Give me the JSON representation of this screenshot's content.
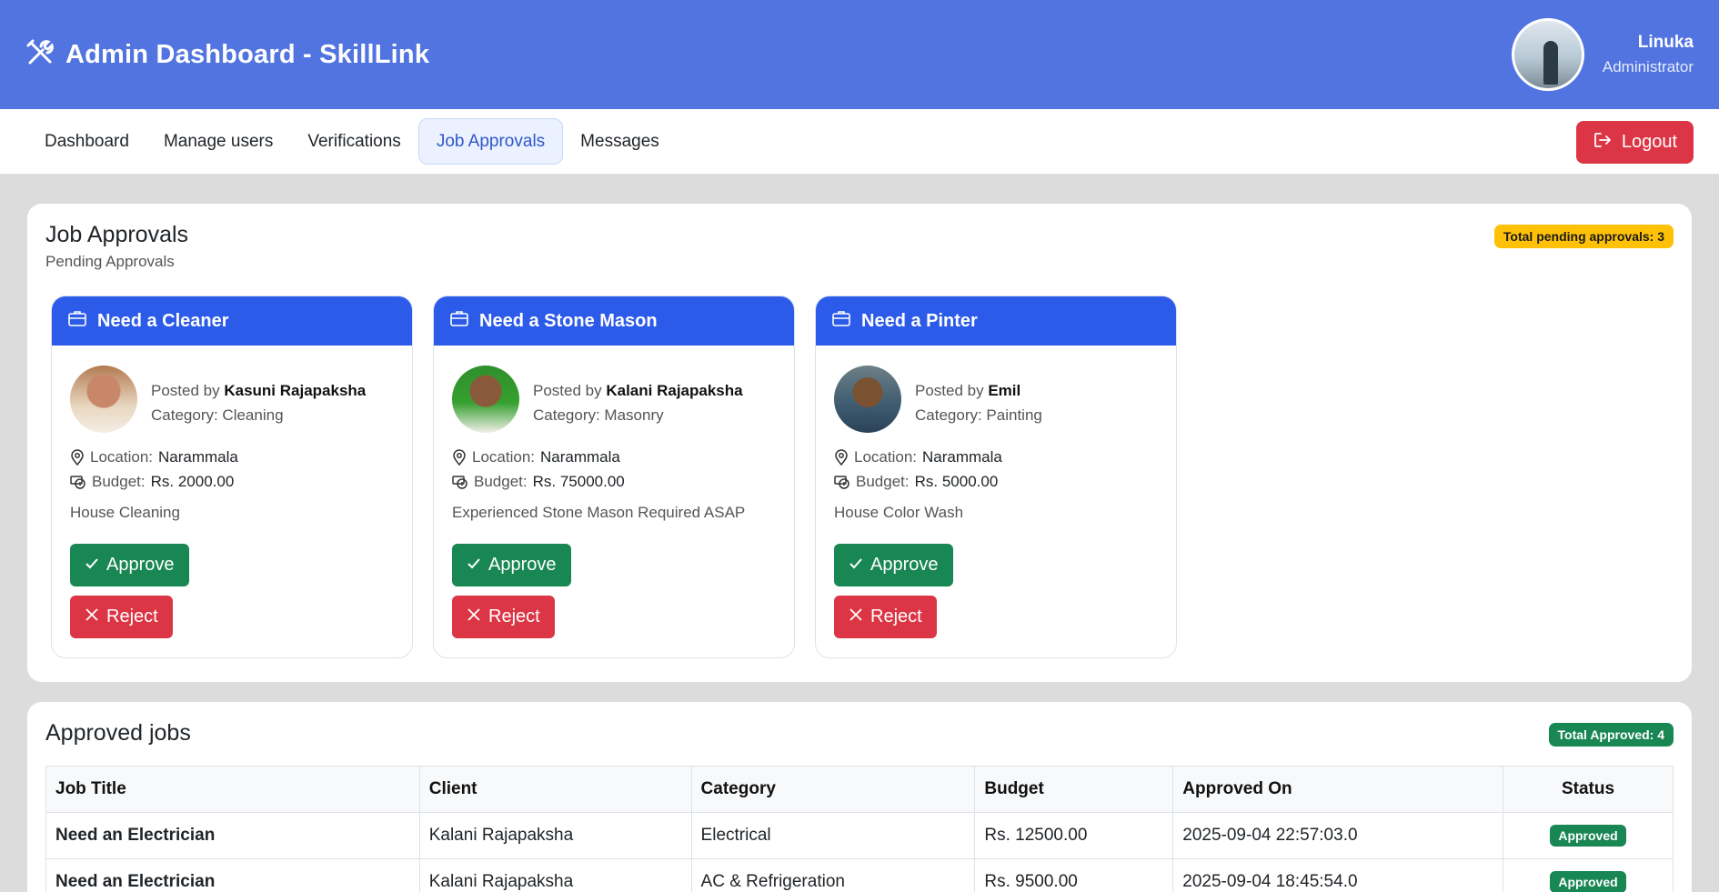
{
  "header": {
    "title": "Admin Dashboard - SkillLink",
    "logo_icon": "tools-icon",
    "user": {
      "name": "Linuka",
      "role": "Administrator"
    }
  },
  "nav": {
    "items": [
      {
        "label": "Dashboard"
      },
      {
        "label": "Manage users"
      },
      {
        "label": "Verifications"
      },
      {
        "label": "Job Approvals"
      },
      {
        "label": "Messages"
      }
    ],
    "active": "Job Approvals",
    "logout_label": "Logout"
  },
  "pending": {
    "title": "Job Approvals",
    "subtitle": "Pending Approvals",
    "badge": "Total pending approvals: 3",
    "cards": [
      {
        "title": "Need a Cleaner",
        "posted_prefix": "Posted by",
        "poster": "Kasuni Rajapaksha",
        "category": "Category: Cleaning",
        "location_label": "Location:",
        "location": "Narammala",
        "budget_label": "Budget:",
        "budget": "Rs. 2000.00",
        "description": "House Cleaning",
        "approve_label": "Approve",
        "reject_label": "Reject"
      },
      {
        "title": "Need a Stone Mason",
        "posted_prefix": "Posted by",
        "poster": "Kalani Rajapaksha",
        "category": "Category: Masonry",
        "location_label": "Location:",
        "location": "Narammala",
        "budget_label": "Budget:",
        "budget": "Rs. 75000.00",
        "description": "Experienced Stone Mason Required ASAP",
        "approve_label": "Approve",
        "reject_label": "Reject"
      },
      {
        "title": "Need a Pinter",
        "posted_prefix": "Posted by",
        "poster": "Emil",
        "category": "Category: Painting",
        "location_label": "Location:",
        "location": "Narammala",
        "budget_label": "Budget:",
        "budget": "Rs. 5000.00",
        "description": "House Color Wash",
        "approve_label": "Approve",
        "reject_label": "Reject"
      }
    ]
  },
  "approved": {
    "title": "Approved jobs",
    "badge": "Total Approved: 4",
    "columns": [
      "Job Title",
      "Client",
      "Category",
      "Budget",
      "Approved On",
      "Status"
    ],
    "rows": [
      [
        "Need an Electrician",
        "Kalani Rajapaksha",
        "Electrical",
        "Rs. 12500.00",
        "2025-09-04 22:57:03.0",
        "Approved"
      ],
      [
        "Need an Electrician",
        "Kalani Rajapaksha",
        "AC & Refrigeration",
        "Rs. 9500.00",
        "2025-09-04 18:45:54.0",
        "Approved"
      ]
    ]
  },
  "colors": {
    "header_bg": "#5174e0",
    "card_head": "#2c5bea",
    "approve": "#198754",
    "reject": "#dc3545",
    "warning_badge": "#ffc107"
  }
}
